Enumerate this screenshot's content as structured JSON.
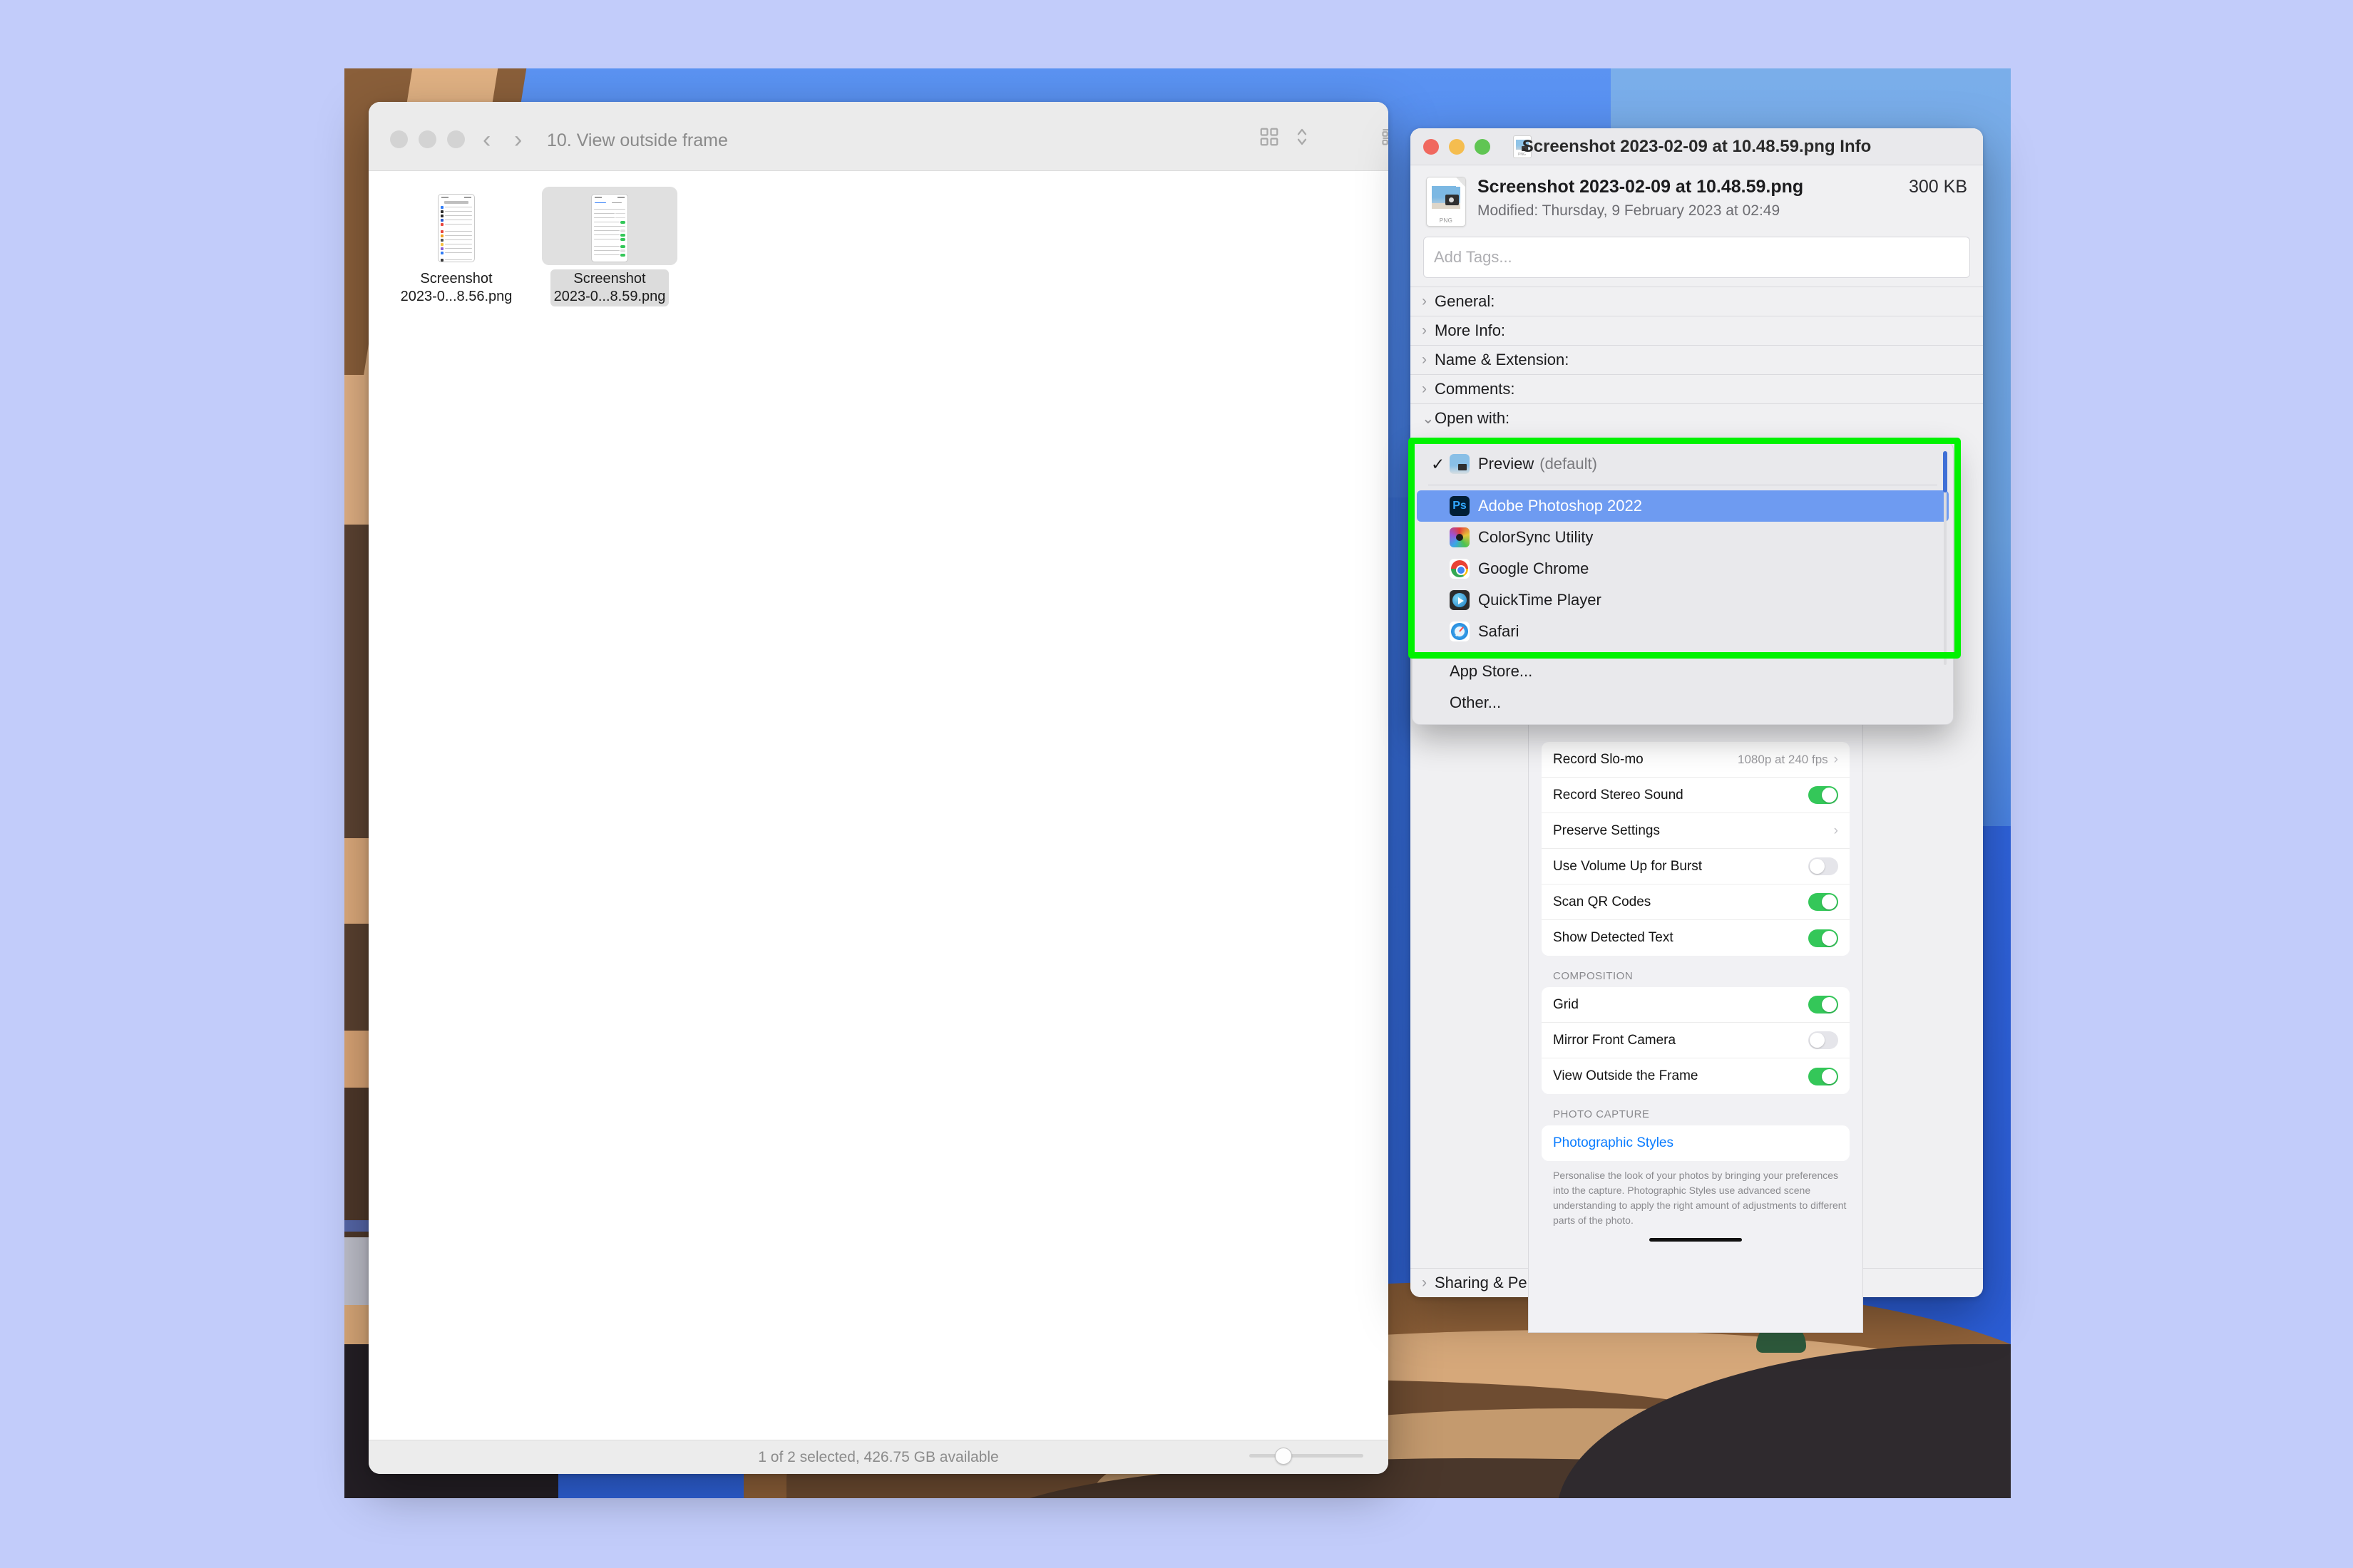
{
  "page": {
    "background_color": "#c2ccfa"
  },
  "finder": {
    "title": "10. View outside frame",
    "toolbar": {
      "back_icon": "chevron-left-icon",
      "forward_icon": "chevron-right-icon",
      "view_icon": "grid-view-icon",
      "sort_icon": "sort-updown-icon",
      "group_icon": "group-list-icon",
      "share_icon": "share-icon",
      "tag_icon": "tag-icon",
      "more_icon": "more-ellipsis-icon",
      "search_icon": "search-icon"
    },
    "files": [
      {
        "name_line1": "Screenshot",
        "name_line2": "2023-0...8.56.png",
        "selected": false
      },
      {
        "name_line1": "Screenshot",
        "name_line2": "2023-0...8.59.png",
        "selected": true
      }
    ],
    "status_text": "1 of 2 selected, 426.75 GB available"
  },
  "info_window": {
    "title": "Screenshot 2023-02-09 at 10.48.59.png Info",
    "title_icon": "png-file-icon",
    "filename": "Screenshot 2023-02-09 at 10.48.59.png",
    "file_size": "300 KB",
    "modified": "Modified: Thursday, 9 February 2023 at 02:49",
    "tags_placeholder": "Add Tags...",
    "file_icon_label": "PNG",
    "sections": [
      {
        "label": "General:",
        "expanded": false
      },
      {
        "label": "More Info:",
        "expanded": false
      },
      {
        "label": "Name & Extension:",
        "expanded": false
      },
      {
        "label": "Comments:",
        "expanded": false
      },
      {
        "label": "Open with:",
        "expanded": true
      }
    ],
    "footer_section": {
      "label": "Sharing & Permissions:",
      "expanded": false
    }
  },
  "openwith_menu": {
    "default_item": {
      "label": "Preview",
      "suffix": "(default)",
      "icon": "preview-app-icon",
      "checked": true
    },
    "apps": [
      {
        "label": "Adobe Photoshop 2022",
        "icon": "photoshop-app-icon",
        "highlighted": true
      },
      {
        "label": "ColorSync Utility",
        "icon": "colorsync-app-icon",
        "highlighted": false
      },
      {
        "label": "Google Chrome",
        "icon": "chrome-app-icon",
        "highlighted": false
      },
      {
        "label": "QuickTime Player",
        "icon": "quicktime-app-icon",
        "highlighted": false
      },
      {
        "label": "Safari",
        "icon": "safari-app-icon",
        "highlighted": false
      }
    ],
    "footer_items": [
      {
        "label": "App Store..."
      },
      {
        "label": "Other..."
      }
    ]
  },
  "ios_preview": {
    "rows": [
      {
        "label": "Record Slo-mo",
        "value": "1080p at 240 fps",
        "type": "chevron"
      },
      {
        "label": "Record Stereo Sound",
        "type": "toggle",
        "on": true
      },
      {
        "label": "Preserve Settings",
        "type": "chevron"
      },
      {
        "label": "Use Volume Up for Burst",
        "type": "toggle",
        "on": false
      },
      {
        "label": "Scan QR Codes",
        "type": "toggle",
        "on": true
      },
      {
        "label": "Show Detected Text",
        "type": "toggle",
        "on": true
      }
    ],
    "composition_header": "COMPOSITION",
    "composition_rows": [
      {
        "label": "Grid",
        "type": "toggle",
        "on": true
      },
      {
        "label": "Mirror Front Camera",
        "type": "toggle",
        "on": false
      },
      {
        "label": "View Outside the Frame",
        "type": "toggle",
        "on": true
      }
    ],
    "photo_capture_header": "PHOTO CAPTURE",
    "photographic_styles_link": "Photographic Styles",
    "photographic_styles_note": "Personalise the look of your photos by bringing your preferences into the capture. Photographic Styles use advanced scene understanding to apply the right amount of adjustments to different parts of the photo."
  },
  "annotation": {
    "highlight_color": "#00f200"
  }
}
